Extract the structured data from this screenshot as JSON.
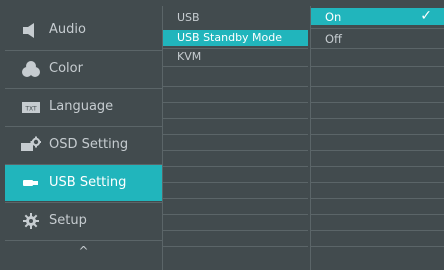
{
  "menu": {
    "items": [
      {
        "label": "Audio",
        "icon": "speaker-icon",
        "active": false
      },
      {
        "label": "Color",
        "icon": "color-palette-icon",
        "active": false
      },
      {
        "label": "Language",
        "icon": "txt-language-icon",
        "active": false
      },
      {
        "label": "OSD Setting",
        "icon": "osd-setting-icon",
        "active": false
      },
      {
        "label": "USB Setting",
        "icon": "usb-icon",
        "active": true
      },
      {
        "label": "Setup",
        "icon": "gear-icon",
        "active": false
      }
    ],
    "scroll_up_glyph": "^",
    "txt_icon_text": "TXT"
  },
  "submenu": {
    "items": [
      {
        "label": "USB",
        "active": false
      },
      {
        "label": "USB Standby Mode",
        "active": true
      },
      {
        "label": "KVM",
        "active": false
      }
    ]
  },
  "options": {
    "items": [
      {
        "label": "On",
        "active": true,
        "checked": true
      },
      {
        "label": "Off",
        "active": false,
        "checked": false
      }
    ],
    "check_glyph": "✓"
  },
  "colors": {
    "background": "#424b4e",
    "accent": "#21b5bc",
    "text": "#c6ccd0",
    "divider": "#5b6568"
  }
}
